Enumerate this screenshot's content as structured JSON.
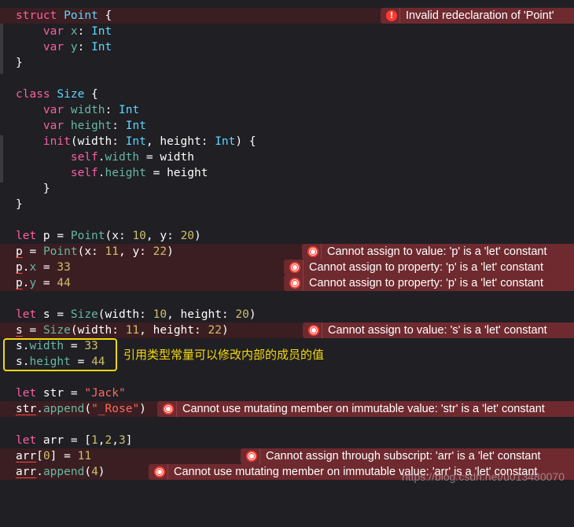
{
  "errors": {
    "e1": "Invalid redeclaration of 'Point'",
    "e2": "Cannot assign to value: 'p' is a 'let' constant",
    "e3": "Cannot assign to property: 'p' is a 'let' constant",
    "e4": "Cannot assign to property: 'p' is a 'let' constant",
    "e5": "Cannot assign to value: 's' is a 'let' constant",
    "e6": "Cannot use mutating member on immutable value: 'str' is a 'let' constant",
    "e7": "Cannot assign through subscript: 'arr' is a 'let' constant",
    "e8": "Cannot use mutating member on immutable value: 'arr' is a 'let' constant"
  },
  "annotation": "引用类型常量可以修改内部的成员的值",
  "watermark": "https://blog.csdn.net/u013480070",
  "colors": {
    "error_badge": "#6e2a2f",
    "error_icon": "#ff3b30",
    "highlight": "#f4d90b"
  }
}
